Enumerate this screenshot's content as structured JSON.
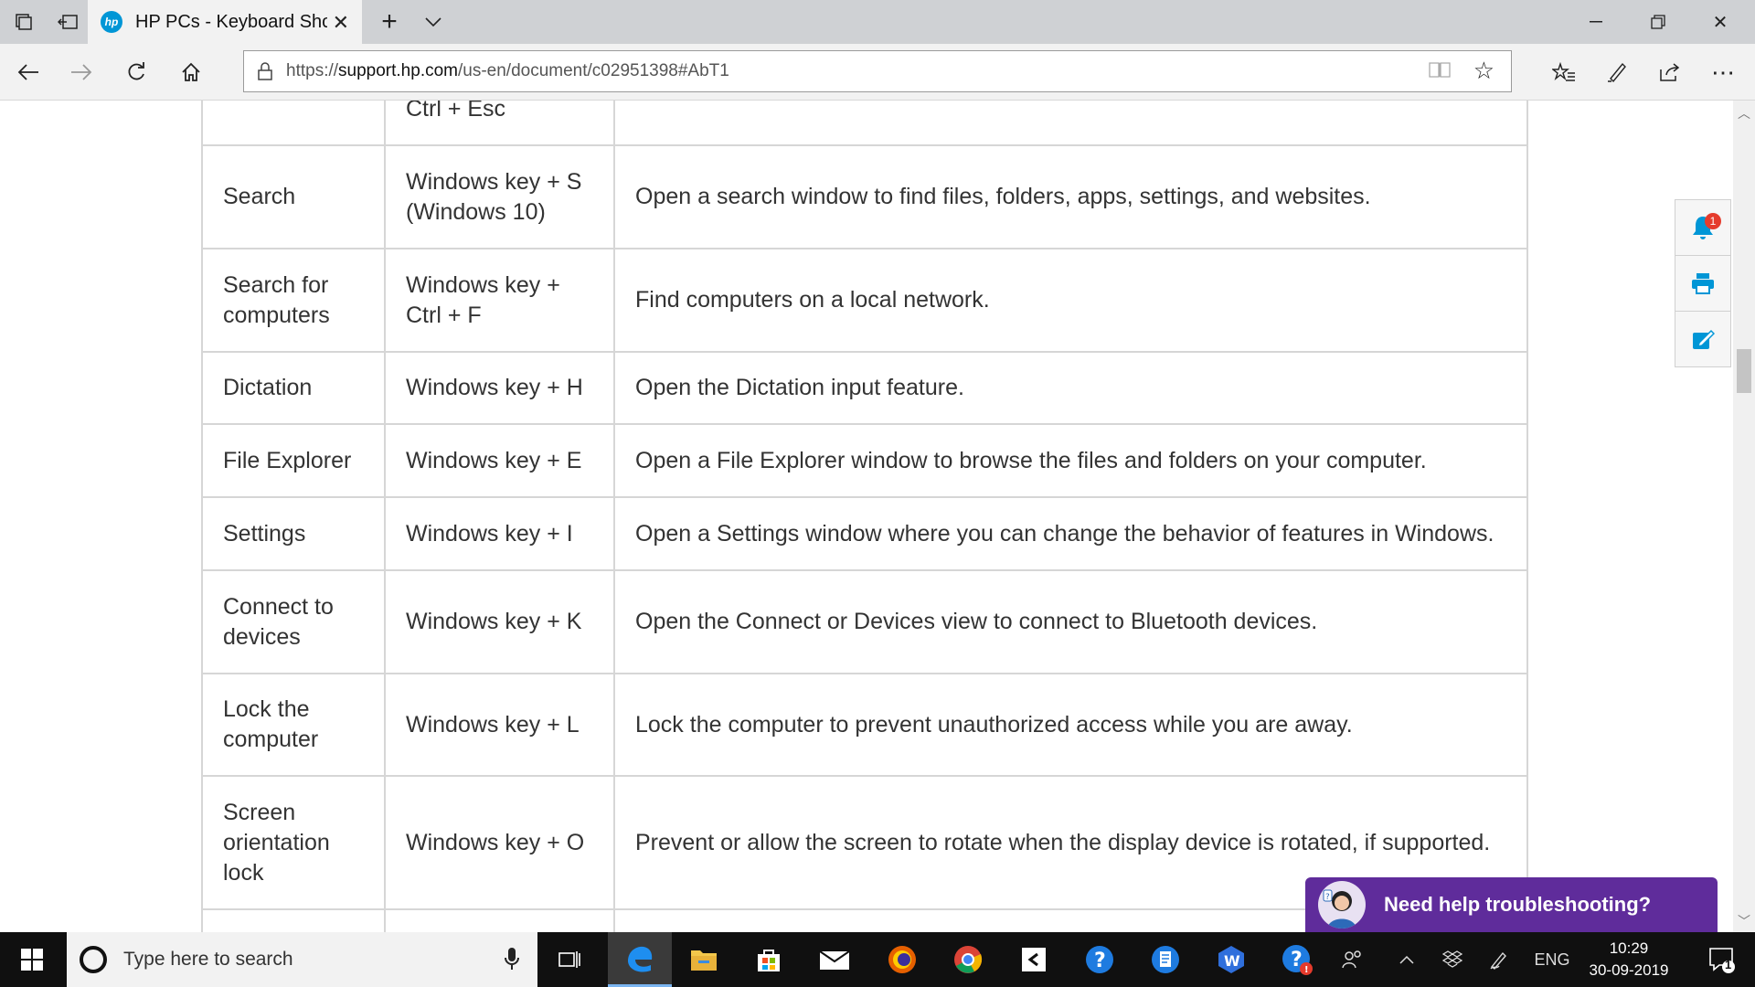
{
  "browser": {
    "tab": {
      "title": "HP PCs - Keyboard Shor",
      "favicon_text": "hp"
    },
    "url_domain": "support.hp.com",
    "url_prefix": "https://",
    "url_path": "/us-en/document/c02951398#AbT1"
  },
  "table": {
    "rows": [
      {
        "function": "",
        "shortcut": "Ctrl + Esc",
        "description": ""
      },
      {
        "function": "Search",
        "shortcut": "Windows key + S (Windows 10)",
        "description": "Open a search window to find files, folders, apps, settings, and websites."
      },
      {
        "function": "Search for computers",
        "shortcut": "Windows key + Ctrl + F",
        "description": "Find computers on a local network."
      },
      {
        "function": "Dictation",
        "shortcut": "Windows key + H",
        "description": "Open the Dictation input feature."
      },
      {
        "function": "File Explorer",
        "shortcut": "Windows key + E",
        "description": "Open a File Explorer window to browse the files and folders on your computer."
      },
      {
        "function": "Settings",
        "shortcut": "Windows key + I",
        "description": "Open a Settings window where you can change the behavior of features in Windows."
      },
      {
        "function": "Connect to devices",
        "shortcut": "Windows key + K",
        "description": "Open the Connect or Devices view to connect to Bluetooth devices."
      },
      {
        "function": "Lock the computer",
        "shortcut": "Windows key + L",
        "description": "Lock the computer to prevent unauthorized access while you are away."
      },
      {
        "function": "Screen orientation lock",
        "shortcut": "Windows key + O",
        "description": "Prevent or allow the screen to rotate when the display device is rotated, if supported."
      },
      {
        "function": "",
        "shortcut": "",
        "description": ""
      }
    ]
  },
  "side_tools": {
    "notification_count": "1"
  },
  "chat": {
    "label": "Need help troubleshooting?"
  },
  "taskbar": {
    "search_placeholder": "Type here to search",
    "language": "ENG",
    "time": "10:29",
    "date": "30-09-2019",
    "notification_count": "1"
  },
  "colors": {
    "chat_bg": "#5f2c9b",
    "hp_blue": "#0096d6",
    "taskbar_bg": "#101010"
  }
}
